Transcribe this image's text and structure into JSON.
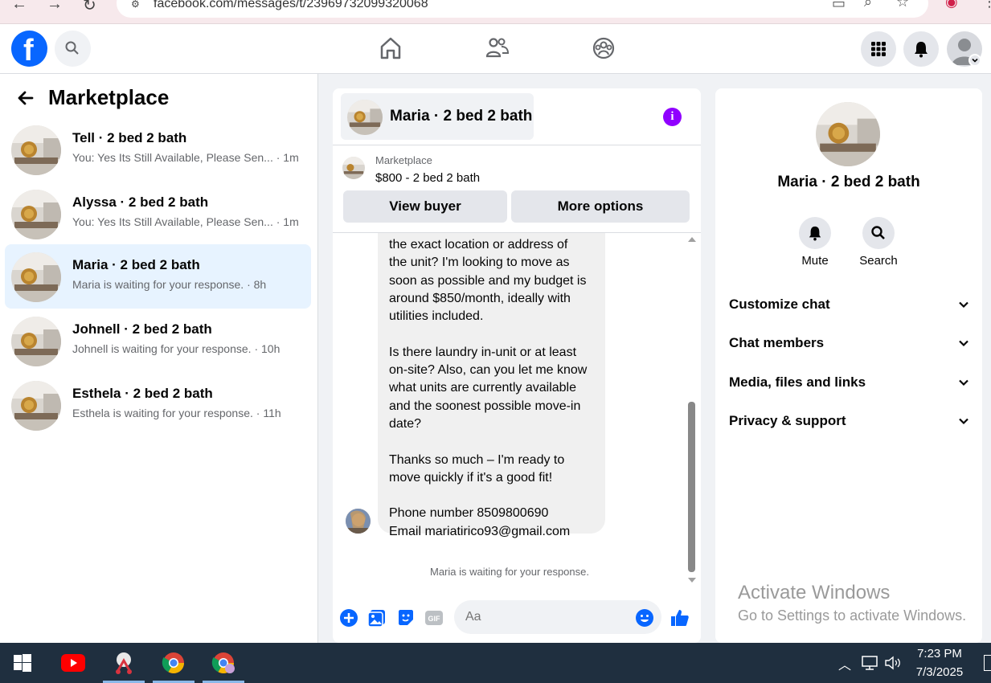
{
  "browser": {
    "url": "facebook.com/messages/t/23969732099320068"
  },
  "colors": {
    "fb_blue": "#0866ff",
    "info_purple": "#9000ff",
    "active_row": "#e7f3ff",
    "taskbar": "#1f2f3f"
  },
  "left_panel": {
    "title": "Marketplace",
    "conversations": [
      {
        "name": "Tell · 2 bed 2 bath",
        "preview": "You: Yes Its Still Available, Please Sen... · 1m"
      },
      {
        "name": "Alyssa · 2 bed 2 bath",
        "preview": "You: Yes Its Still Available, Please Sen... · 1m"
      },
      {
        "name": "Maria · 2 bed 2 bath",
        "preview": "Maria is waiting for your response. · 8h"
      },
      {
        "name": "Johnell · 2 bed 2 bath",
        "preview": "Johnell is waiting for your response. · 10h"
      },
      {
        "name": "Esthela · 2 bed 2 bath",
        "preview": "Esthela is waiting for your response. · 11h"
      }
    ]
  },
  "chat": {
    "title": "Maria · 2 bed 2 bath",
    "marketplace_label": "Marketplace",
    "listing_price": "$800 - 2 bed 2 bath",
    "view_buyer": "View buyer",
    "more_options": "More options",
    "message": "the exact location or address of\nthe unit? I'm looking to move as\nsoon as possible and my budget is\naround $850/month, ideally with\nutilities included.\n\nIs there laundry in-unit or at least\non-site? Also, can you let me know\nwhat units are currently available\nand the soonest possible move-in\ndate?\n\nThanks so much – I'm ready to\nmove quickly if it's a good fit!\n\nPhone number 8509800690\nEmail mariatirico93@gmail.com",
    "waiting_text": "Maria is waiting for your response.",
    "input_placeholder": "Aa"
  },
  "right_panel": {
    "name": "Maria · 2 bed 2 bath",
    "mute_label": "Mute",
    "search_label": "Search",
    "sections": [
      "Customize chat",
      "Chat members",
      "Media, files and links",
      "Privacy & support"
    ]
  },
  "watermark": {
    "line1": "Activate Windows",
    "line2": "Go to Settings to activate Windows."
  },
  "taskbar": {
    "time": "7:23 PM",
    "date": "7/3/2025"
  }
}
